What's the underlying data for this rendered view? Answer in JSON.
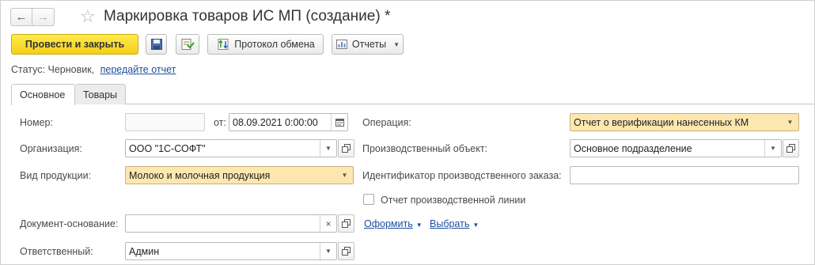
{
  "window": {
    "title": "Маркировка товаров ИС МП (создание) *"
  },
  "toolbar": {
    "post_close_label": "Провести и закрыть",
    "exchange_log_label": "Протокол обмена",
    "reports_label": "Отчеты"
  },
  "status": {
    "label": "Статус:",
    "value": "Черновик,",
    "link": "передайте отчет"
  },
  "tabs": [
    {
      "label": "Основное",
      "active": true
    },
    {
      "label": "Товары",
      "active": false
    }
  ],
  "form": {
    "number": {
      "label": "Номер:",
      "value": ""
    },
    "date": {
      "label": "от:",
      "value": "08.09.2021  0:00:00"
    },
    "organization": {
      "label": "Организация:",
      "value": "ООО \"1С-СОФТ\""
    },
    "product_type": {
      "label": "Вид продукции:",
      "value": "Молоко и молочная продукция"
    },
    "base_document": {
      "label": "Документ-основание:",
      "value": ""
    },
    "responsible": {
      "label": "Ответственный:",
      "value": "Админ"
    },
    "operation": {
      "label": "Операция:",
      "value": "Отчет о верификации нанесенных КМ"
    },
    "production_object": {
      "label": "Производственный объект:",
      "value": "Основное подразделение"
    },
    "production_order_id": {
      "label": "Идентификатор производственного заказа:",
      "value": ""
    },
    "production_line_report": {
      "label": "Отчет производственной линии",
      "checked": false
    },
    "actions": {
      "issue_label": "Оформить",
      "select_label": "Выбрать"
    }
  },
  "colors": {
    "primary_button": "#f4cf1a",
    "highlight_field": "#fde7b0",
    "link": "#1d4f9e"
  },
  "icons": [
    "arrow-left-icon",
    "arrow-right-icon",
    "star-icon",
    "save-icon",
    "post-icon",
    "exchange-log-icon",
    "reports-icon",
    "calendar-icon",
    "open-form-icon",
    "clear-icon",
    "chevron-down-icon"
  ]
}
